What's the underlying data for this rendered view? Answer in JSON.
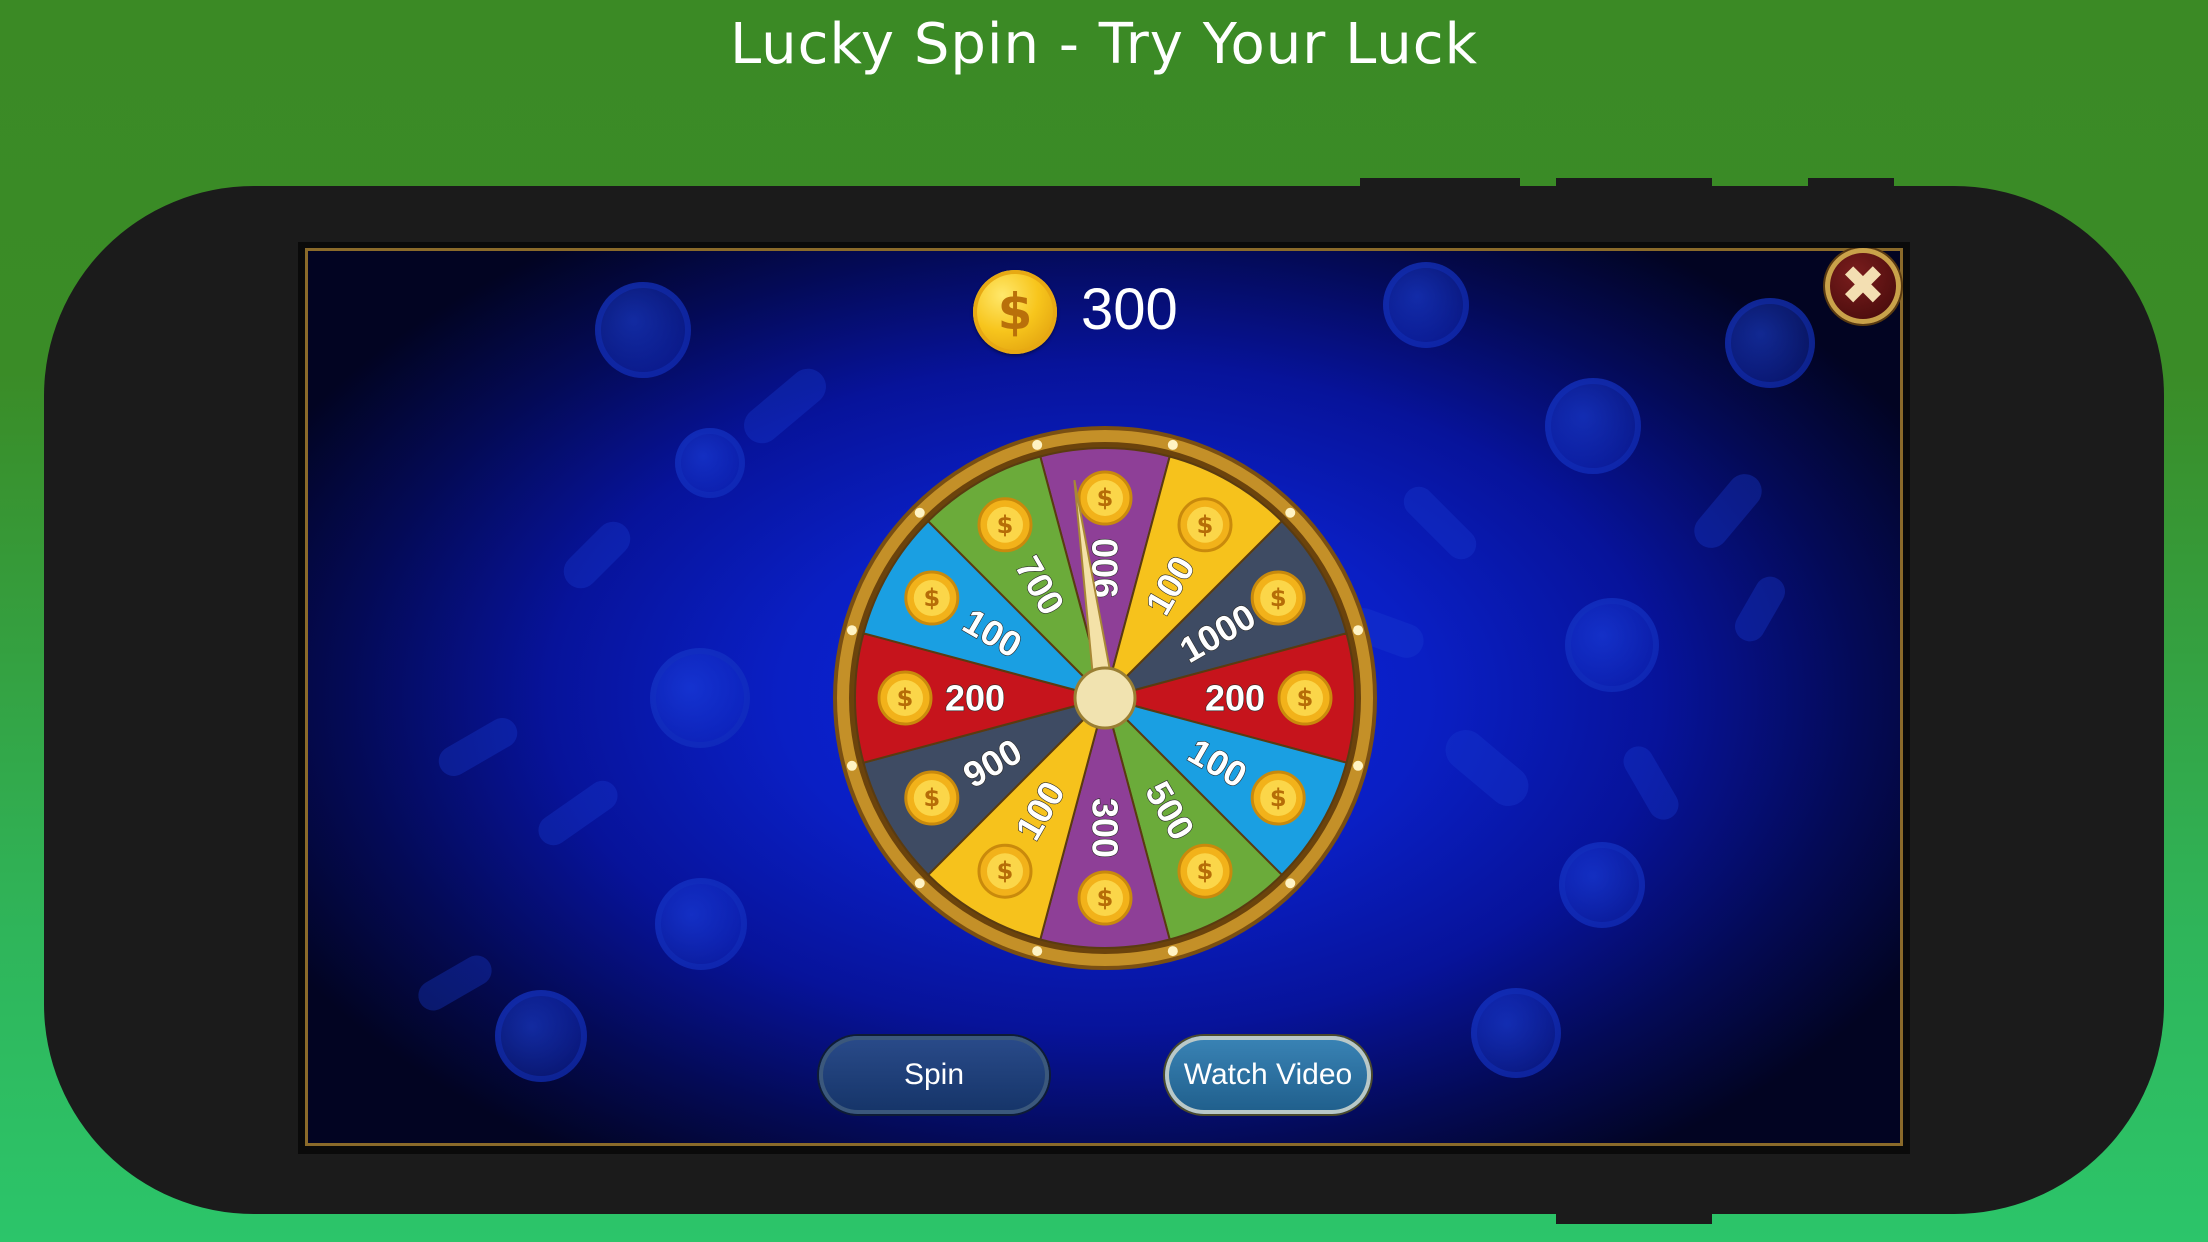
{
  "promo": {
    "title": "Lucky Spin - Try Your Luck"
  },
  "game": {
    "balance": {
      "icon": "dollar-coin-icon",
      "value": "300",
      "coin_symbol": "$"
    },
    "close_icon": "close-x-icon",
    "close_symbol": "✖",
    "wheel": {
      "segments": [
        {
          "value": "900",
          "color": "#8e3f97"
        },
        {
          "value": "100",
          "color": "#f6c21c"
        },
        {
          "value": "1000",
          "color": "#3e4b63"
        },
        {
          "value": "200",
          "color": "#c6141c"
        },
        {
          "value": "100",
          "color": "#1a9fe2"
        },
        {
          "value": "500",
          "color": "#6bab3a"
        },
        {
          "value": "300",
          "color": "#8e3f97"
        },
        {
          "value": "100",
          "color": "#f6c21c"
        },
        {
          "value": "900",
          "color": "#3e4b63"
        },
        {
          "value": "200",
          "color": "#c6141c"
        },
        {
          "value": "100",
          "color": "#1a9fe2"
        },
        {
          "value": "700",
          "color": "#6bab3a"
        }
      ],
      "rim_color": "#c49028",
      "pointer_color": "#f4e2a8"
    },
    "buttons": {
      "spin": "Spin",
      "watch_video": "Watch Video"
    }
  }
}
